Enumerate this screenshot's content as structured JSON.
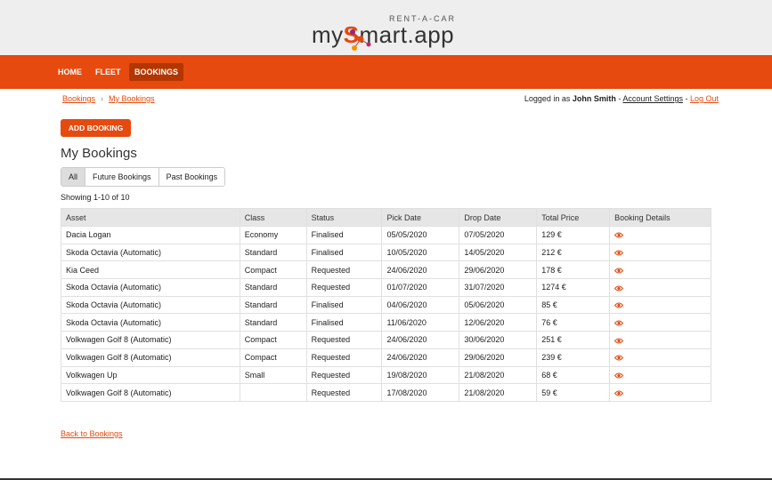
{
  "brand": {
    "tagline": "RENT-A-CAR",
    "name_prefix": "my",
    "name_s": "S",
    "name_suffix": "mart.app",
    "accent": "#e64a0e"
  },
  "nav": {
    "items": [
      {
        "label": "HOME",
        "active": false
      },
      {
        "label": "FLEET",
        "active": false
      },
      {
        "label": "BOOKINGS",
        "active": true
      }
    ]
  },
  "breadcrumb": {
    "root": "Bookings",
    "current": "My Bookings"
  },
  "user": {
    "prefix": "Logged in as",
    "name": "John Smith",
    "sep1": " - ",
    "account": "Account Settings",
    "sep2": " - ",
    "logout": "Log Out"
  },
  "actions": {
    "add_booking": "ADD BOOKING"
  },
  "page": {
    "title": "My Bookings",
    "showing": "Showing 1-10 of 10",
    "back": "Back to Bookings"
  },
  "filters": [
    {
      "label": "All",
      "active": true
    },
    {
      "label": "Future Bookings",
      "active": false
    },
    {
      "label": "Past Bookings",
      "active": false
    }
  ],
  "table": {
    "columns": [
      "Asset",
      "Class",
      "Status",
      "Pick Date",
      "Drop Date",
      "Total Price",
      "Booking Details"
    ],
    "rows": [
      [
        "Dacia Logan",
        "Economy",
        "Finalised",
        "05/05/2020",
        "07/05/2020",
        "129 €"
      ],
      [
        "Skoda Octavia (Automatic)",
        "Standard",
        "Finalised",
        "10/05/2020",
        "14/05/2020",
        "212 €"
      ],
      [
        "Kia Ceed",
        "Compact",
        "Requested",
        "24/06/2020",
        "29/06/2020",
        "178 €"
      ],
      [
        "Skoda Octavia (Automatic)",
        "Standard",
        "Requested",
        "01/07/2020",
        "31/07/2020",
        "1274 €"
      ],
      [
        "Skoda Octavia (Automatic)",
        "Standard",
        "Finalised",
        "04/06/2020",
        "05/06/2020",
        "85 €"
      ],
      [
        "Skoda Octavia (Automatic)",
        "Standard",
        "Finalised",
        "11/06/2020",
        "12/06/2020",
        "76 €"
      ],
      [
        "Volkwagen Golf 8 (Automatic)",
        "Compact",
        "Requested",
        "24/06/2020",
        "30/06/2020",
        "251 €"
      ],
      [
        "Volkwagen Golf 8 (Automatic)",
        "Compact",
        "Requested",
        "24/06/2020",
        "29/06/2020",
        "239 €"
      ],
      [
        "Volkwagen Up",
        "Small",
        "Requested",
        "19/08/2020",
        "21/08/2020",
        "68 €"
      ],
      [
        "Volkwagen Golf 8 (Automatic)",
        "",
        "Requested",
        "17/08/2020",
        "21/08/2020",
        "59 €"
      ]
    ]
  },
  "icons": {
    "details": "eye-icon"
  }
}
